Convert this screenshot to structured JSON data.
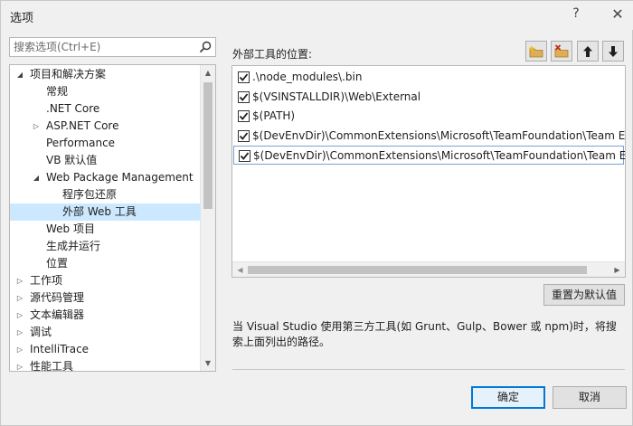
{
  "window": {
    "title": "选项",
    "help_glyph": "?",
    "close_glyph": "✕"
  },
  "search": {
    "placeholder": "搜索选项(Ctrl+E)"
  },
  "tree": {
    "items": [
      {
        "label": "项目和解决方案",
        "state": "expanded"
      },
      {
        "label": "常规"
      },
      {
        "label": ".NET Core"
      },
      {
        "label": "ASP.NET Core",
        "state": "collapsed"
      },
      {
        "label": "Performance"
      },
      {
        "label": "VB 默认值"
      },
      {
        "label": "Web Package Management",
        "state": "expanded"
      },
      {
        "label": "程序包还原"
      },
      {
        "label": "外部 Web 工具",
        "selected": true
      },
      {
        "label": "Web 项目"
      },
      {
        "label": "生成并运行"
      },
      {
        "label": "位置"
      },
      {
        "label": "工作项",
        "state": "collapsed"
      },
      {
        "label": "源代码管理",
        "state": "collapsed"
      },
      {
        "label": "文本编辑器",
        "state": "collapsed"
      },
      {
        "label": "调试",
        "state": "collapsed"
      },
      {
        "label": "IntelliTrace",
        "state": "collapsed"
      },
      {
        "label": "性能工具",
        "state": "collapsed"
      }
    ]
  },
  "locations": {
    "label": "外部工具的位置:",
    "toolbar": {
      "add_icon": "new-folder-icon",
      "remove_icon": "delete-folder-icon",
      "up_icon": "arrow-up-icon",
      "down_icon": "arrow-down-icon"
    },
    "paths": [
      {
        "text": ".\\node_modules\\.bin",
        "checked": true
      },
      {
        "text": "$(VSINSTALLDIR)\\Web\\External",
        "checked": true
      },
      {
        "text": "$(PATH)",
        "checked": true
      },
      {
        "text": "$(DevEnvDir)\\CommonExtensions\\Microsoft\\TeamFoundation\\Team Explorer",
        "checked": true
      },
      {
        "text": "$(DevEnvDir)\\CommonExtensions\\Microsoft\\TeamFoundation\\Team Explorer",
        "checked": true,
        "selected": true
      }
    ]
  },
  "reset_label": "重置为默认值",
  "description": "当 Visual Studio 使用第三方工具(如 Grunt、Gulp、Bower 或 npm)时，将搜索上面列出的路径。",
  "buttons": {
    "ok": "确定",
    "cancel": "取消"
  },
  "colors": {
    "selection": "#cce8ff",
    "accent": "#0078d7",
    "toolbar_icon": "#d9a441"
  }
}
